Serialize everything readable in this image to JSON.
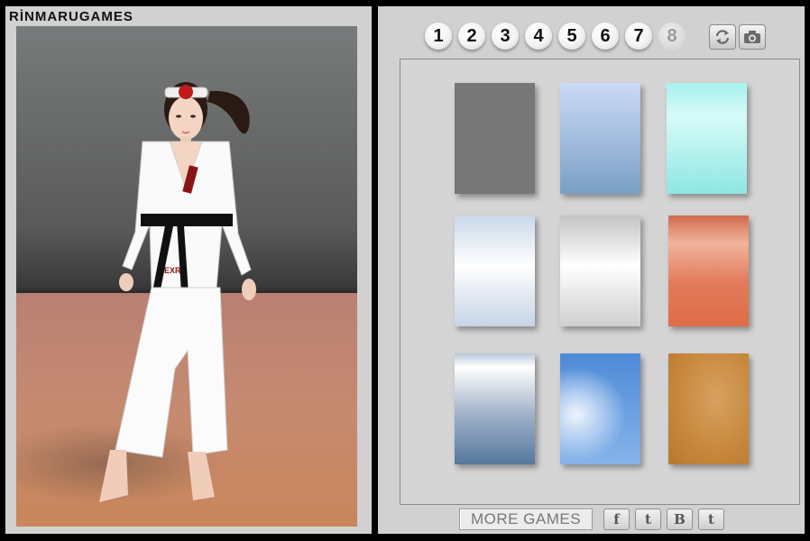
{
  "brand": {
    "title": "RİNMARUGAMES"
  },
  "character": {
    "belt_text": "EXR",
    "chest_text": "EXR"
  },
  "tabs": [
    {
      "label": "1",
      "enabled": true
    },
    {
      "label": "2",
      "enabled": true
    },
    {
      "label": "3",
      "enabled": true
    },
    {
      "label": "4",
      "enabled": true
    },
    {
      "label": "5",
      "enabled": true
    },
    {
      "label": "6",
      "enabled": true
    },
    {
      "label": "7",
      "enabled": true
    },
    {
      "label": "8",
      "enabled": false
    }
  ],
  "tools": {
    "reset_icon": "refresh-icon",
    "camera_icon": "camera-icon"
  },
  "swatches": [
    {
      "id": "gray",
      "colors": [
        "#777777",
        "#7c7c7c"
      ]
    },
    {
      "id": "periwinkle",
      "colors": [
        "#cbdaf7",
        "#7a9fc5"
      ]
    },
    {
      "id": "aqua",
      "colors": [
        "#a7f1ef",
        "#8ee6e2"
      ]
    },
    {
      "id": "pale-blue",
      "colors": [
        "#d0dcec",
        "#f4f7fa"
      ]
    },
    {
      "id": "silver",
      "colors": [
        "#c7c7c7",
        "#ececec"
      ]
    },
    {
      "id": "coral",
      "colors": [
        "#e27b5c",
        "#f2b39c"
      ]
    },
    {
      "id": "steel",
      "colors": [
        "#d3dfea",
        "#5d7ea6"
      ]
    },
    {
      "id": "sky",
      "colors": [
        "#5e96e0",
        "#a9c8ef"
      ]
    },
    {
      "id": "tan",
      "colors": [
        "#c7873a",
        "#d7a160"
      ]
    }
  ],
  "footer": {
    "more_games": "MORE GAMES",
    "social": [
      {
        "label": "f",
        "icon": "facebook-icon"
      },
      {
        "label": "t",
        "icon": "twitter-icon"
      },
      {
        "label": "B",
        "icon": "blogger-icon"
      },
      {
        "label": "t",
        "icon": "tumblr-icon"
      }
    ]
  }
}
